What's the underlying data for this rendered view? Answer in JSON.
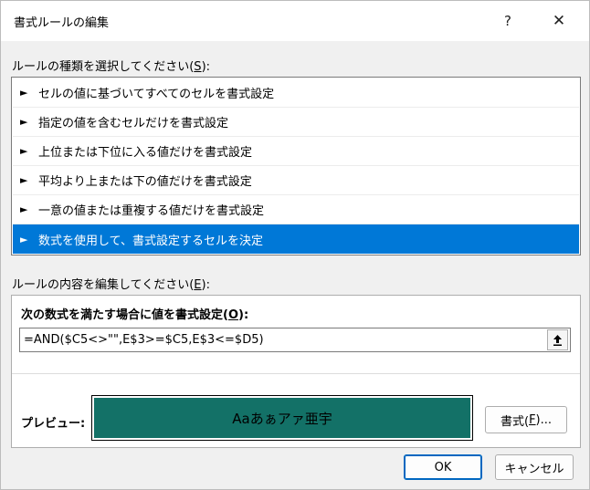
{
  "dialog": {
    "title": "書式ルールの編集",
    "help": "?",
    "close": "✕"
  },
  "rule_type": {
    "label_prefix": "ルールの種類を選択してください(",
    "label_key": "S",
    "label_suffix": "):",
    "items": [
      "セルの値に基づいてすべてのセルを書式設定",
      "指定の値を含むセルだけを書式設定",
      "上位または下位に入る値だけを書式設定",
      "平均より上または下の値だけを書式設定",
      "一意の値または重複する値だけを書式設定",
      "数式を使用して、書式設定するセルを決定"
    ],
    "selected_index": 5,
    "bullet": "►"
  },
  "rule_edit": {
    "label_prefix": "ルールの内容を編集してください(",
    "label_key": "E",
    "label_suffix": "):",
    "formula_label_prefix": "次の数式を満たす場合に値を書式設定(",
    "formula_label_key": "O",
    "formula_label_suffix": "):",
    "formula_value": "=AND($C5<>\"\",E$3>=$C5,E$3<=$D5)",
    "preview_label": "プレビュー:",
    "preview_text": "Aaあぁアァ亜宇",
    "preview_fill_color": "#137167",
    "format_button_prefix": "書式(",
    "format_button_key": "F",
    "format_button_suffix": ")..."
  },
  "buttons": {
    "ok": "OK",
    "cancel": "キャンセル"
  },
  "colors": {
    "selection": "#0078d7",
    "default_border": "#0067c0"
  }
}
